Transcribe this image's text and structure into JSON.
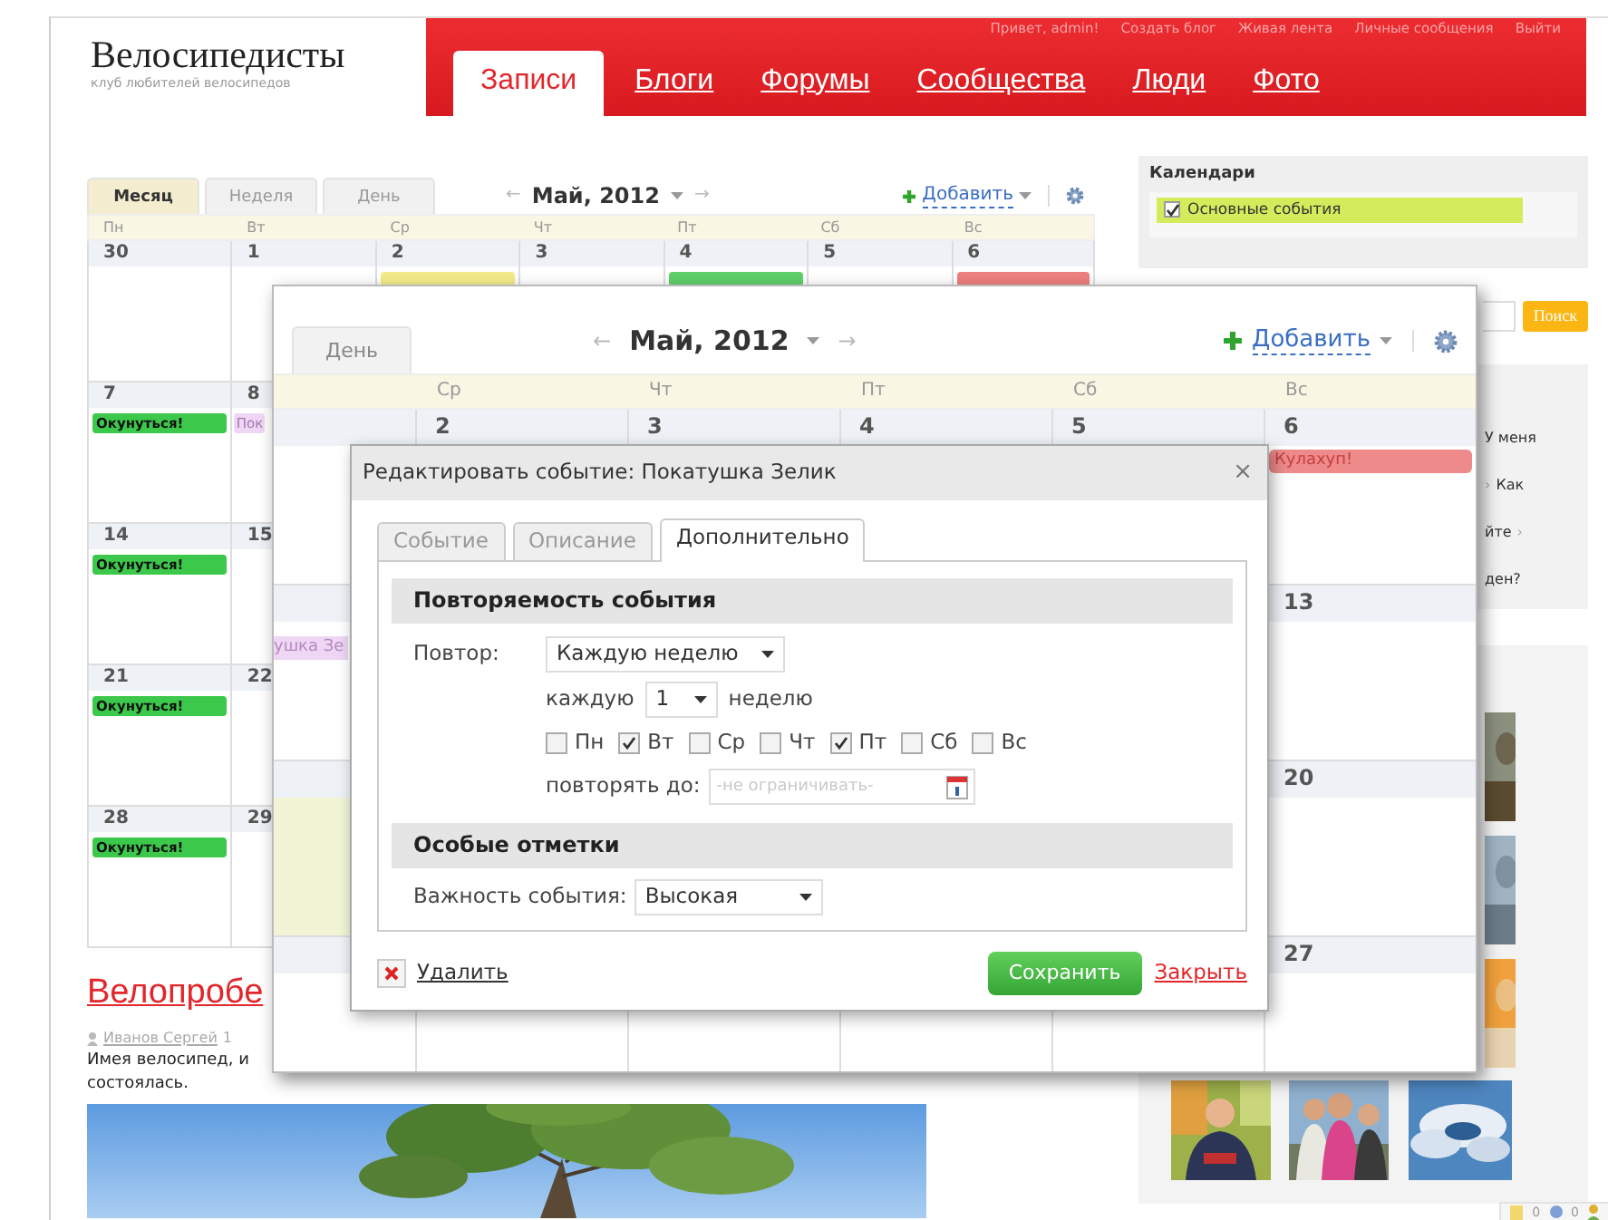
{
  "header": {
    "logo": "Велосипедисты",
    "tagline": "клуб любителей велосипедов",
    "greeting": "Привет, ",
    "username": "admin",
    "greeting_end": "!",
    "user_links": [
      "Создать блог",
      "Живая лента",
      "Личные сообщения",
      "Выйти"
    ],
    "nav": [
      {
        "label": "Записи",
        "selected": true
      },
      {
        "label": "Блоги",
        "selected": false
      },
      {
        "label": "Форумы",
        "selected": false
      },
      {
        "label": "Сообщества",
        "selected": false
      },
      {
        "label": "Люди",
        "selected": false
      },
      {
        "label": "Фото",
        "selected": false
      }
    ]
  },
  "calendar": {
    "view_tabs": [
      {
        "label": "Месяц",
        "selected": true
      },
      {
        "label": "Неделя",
        "selected": false
      },
      {
        "label": "День",
        "selected": false
      }
    ],
    "prev": "←",
    "month": "Май, 2012",
    "next": "→",
    "add": "Добавить",
    "weekdays": [
      "Пн",
      "Вт",
      "Ср",
      "Чт",
      "Пт",
      "Сб",
      "Вс"
    ],
    "weeks": [
      {
        "days": [
          {
            "number": "30"
          },
          {
            "number": "1"
          },
          {
            "number": "2",
            "events": [
              {
                "color": "#f4ec8a"
              }
            ]
          },
          {
            "number": "3"
          },
          {
            "number": "4",
            "events": [
              {
                "color": "#5fd06a"
              }
            ]
          },
          {
            "number": "5"
          },
          {
            "number": "6",
            "events": [
              {
                "color": "#ee7f7f"
              }
            ]
          }
        ]
      },
      {
        "days": [
          {
            "number": "7",
            "events": [
              {
                "label": "Окунуться!",
                "color": "#3cc84a"
              }
            ]
          },
          {
            "number": "8",
            "events": [
              {
                "label": "Пок",
                "color": "#eed6f4"
              }
            ]
          }
        ]
      },
      {
        "days": [
          {
            "number": "14",
            "events": [
              {
                "label": "Окунуться!",
                "color": "#3cc84a"
              }
            ]
          },
          {
            "number": "15"
          }
        ]
      },
      {
        "days": [
          {
            "number": "21",
            "events": [
              {
                "label": "Окунуться!",
                "color": "#3cc84a"
              }
            ]
          },
          {
            "number": "22"
          }
        ]
      },
      {
        "days": [
          {
            "number": "28",
            "events": [
              {
                "label": "Окунуться!",
                "color": "#3cc84a"
              }
            ]
          },
          {
            "number": "29"
          }
        ]
      }
    ]
  },
  "post": {
    "title": "Велопробе",
    "author": "Иванов Сергей",
    "date": "1",
    "text_lines": [
      "Имея велосипед, и",
      "состоялась."
    ],
    "photo": {
      "kind": "picture"
    }
  },
  "sidebar": {
    "calendars": {
      "title": "Календари",
      "items": [
        {
          "label": "Основные события",
          "checked": true,
          "color": "#d4ec5c"
        }
      ]
    },
    "search_button": "Поиск",
    "links": [
      {
        "text": "У меня"
      },
      {
        "prefix": "›",
        "text": "Как"
      },
      {
        "text": "йте",
        "suffix": "›"
      },
      {
        "text": "ден?"
      }
    ],
    "photos": {
      "kind": "picture"
    },
    "counters": [
      "0",
      "0"
    ]
  },
  "zoomed_calendar": {
    "view_tabs": [
      {
        "label": "День",
        "selected": false
      }
    ],
    "prev": "←",
    "month": "Май, 2012",
    "next": "→",
    "add": "Добавить",
    "weekdays": [
      "Ср",
      "Чт",
      "Пт",
      "Сб",
      "Вс"
    ],
    "weeks": [
      {
        "days": [
          {
            "number": "2"
          },
          {
            "number": "3"
          },
          {
            "number": "4"
          },
          {
            "number": "5"
          },
          {
            "number": "6",
            "events": [
              {
                "label": "Кулахуп!",
                "color": "#ee8a8a"
              }
            ]
          }
        ]
      },
      {
        "lead_events": [
          {
            "label": "ушка Зе",
            "color": "#eed6f4"
          }
        ],
        "last_day": {
          "number": "13"
        }
      },
      {
        "lead_today": true,
        "last_day": {
          "number": "20"
        }
      },
      {
        "last_day": {
          "number": "27"
        }
      }
    ]
  },
  "dialog": {
    "title": "Редактировать событие: Покатушка Зелик",
    "close": "×",
    "tabs": [
      {
        "label": "Событие",
        "selected": false
      },
      {
        "label": "Описание",
        "selected": false
      },
      {
        "label": "Дополнительно",
        "selected": true
      }
    ],
    "recurrence": {
      "title": "Повторяемость события",
      "repeat_label": "Повтор:",
      "repeat_value": "Каждую неделю",
      "every_label": "каждую",
      "every_value": "1",
      "every_unit": "неделю",
      "days": [
        {
          "label": "Пн",
          "checked": false
        },
        {
          "label": "Вт",
          "checked": true
        },
        {
          "label": "Ср",
          "checked": false
        },
        {
          "label": "Чт",
          "checked": false
        },
        {
          "label": "Пт",
          "checked": true
        },
        {
          "label": "Сб",
          "checked": false
        },
        {
          "label": "Вс",
          "checked": false
        }
      ],
      "until_label": "повторять до:",
      "until_placeholder": "-не ограничивать-"
    },
    "marks": {
      "title": "Особые отметки",
      "importance_label": "Важность события:",
      "importance_value": "Высокая"
    },
    "delete": "Удалить",
    "save": "Сохранить",
    "close_link": "Закрыть"
  }
}
